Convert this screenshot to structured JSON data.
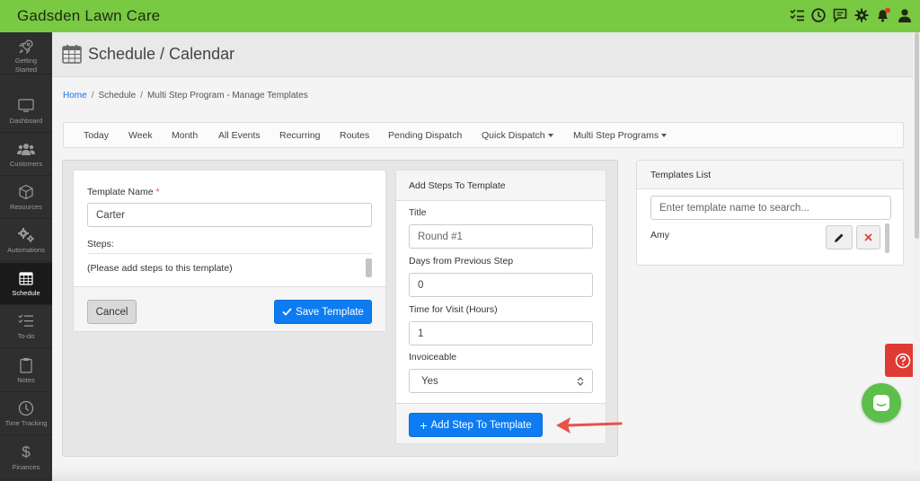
{
  "app": {
    "title": "Gadsden Lawn Care"
  },
  "top_icons": [
    "checklist-icon",
    "clock-icon",
    "chat-icon",
    "gear-icon",
    "bell-icon",
    "user-icon"
  ],
  "sidebar": {
    "items": [
      {
        "label_1": "Getting",
        "label_2": "Started",
        "icon": "rocket-icon"
      },
      {
        "label_1": "Dashboard",
        "icon": "monitor-icon"
      },
      {
        "label_1": "Customers",
        "icon": "users-icon"
      },
      {
        "label_1": "Resources",
        "icon": "cube-icon"
      },
      {
        "label_1": "Automations",
        "icon": "gears-icon"
      },
      {
        "label_1": "Schedule",
        "icon": "calendar-icon"
      },
      {
        "label_1": "To-do",
        "icon": "list-icon"
      },
      {
        "label_1": "Notes",
        "icon": "clipboard-icon"
      },
      {
        "label_1": "Time Tracking",
        "icon": "clock-icon"
      },
      {
        "label_1": "Finances",
        "icon": "dollar-icon"
      }
    ]
  },
  "page": {
    "title": "Schedule / Calendar"
  },
  "breadcrumb": {
    "home": "Home",
    "sep": "/",
    "schedule": "Schedule",
    "current": "Multi Step Program - Manage Templates"
  },
  "nav": {
    "today": "Today",
    "week": "Week",
    "month": "Month",
    "all_events": "All Events",
    "recurring": "Recurring",
    "routes": "Routes",
    "pending_dispatch": "Pending Dispatch",
    "quick_dispatch": "Quick Dispatch",
    "multi_step": "Multi Step Programs"
  },
  "template_form": {
    "name_label": "Template Name",
    "required_mark": "*",
    "name_value": "Carter",
    "steps_label": "Steps:",
    "steps_empty": "(Please add steps to this template)",
    "cancel_label": "Cancel",
    "save_label": "Save Template"
  },
  "add_steps": {
    "header": "Add Steps To Template",
    "title_label": "Title",
    "title_placeholder": "Round #1",
    "days_label": "Days from Previous Step",
    "days_value": "0",
    "time_label": "Time for Visit (Hours)",
    "time_value": "1",
    "invoiceable_label": "Invoiceable",
    "invoiceable_value": "Yes",
    "add_button": "Add Step To Template"
  },
  "templates_list": {
    "header": "Templates List",
    "search_placeholder": "Enter template name to search...",
    "items": [
      {
        "name": "Amy"
      }
    ]
  },
  "colors": {
    "brand_green": "#7ac943",
    "primary_blue": "#0d7cf2",
    "danger_red": "#e03a34",
    "arrow_red": "#e8524a",
    "chat_green": "#5cbf4a"
  }
}
